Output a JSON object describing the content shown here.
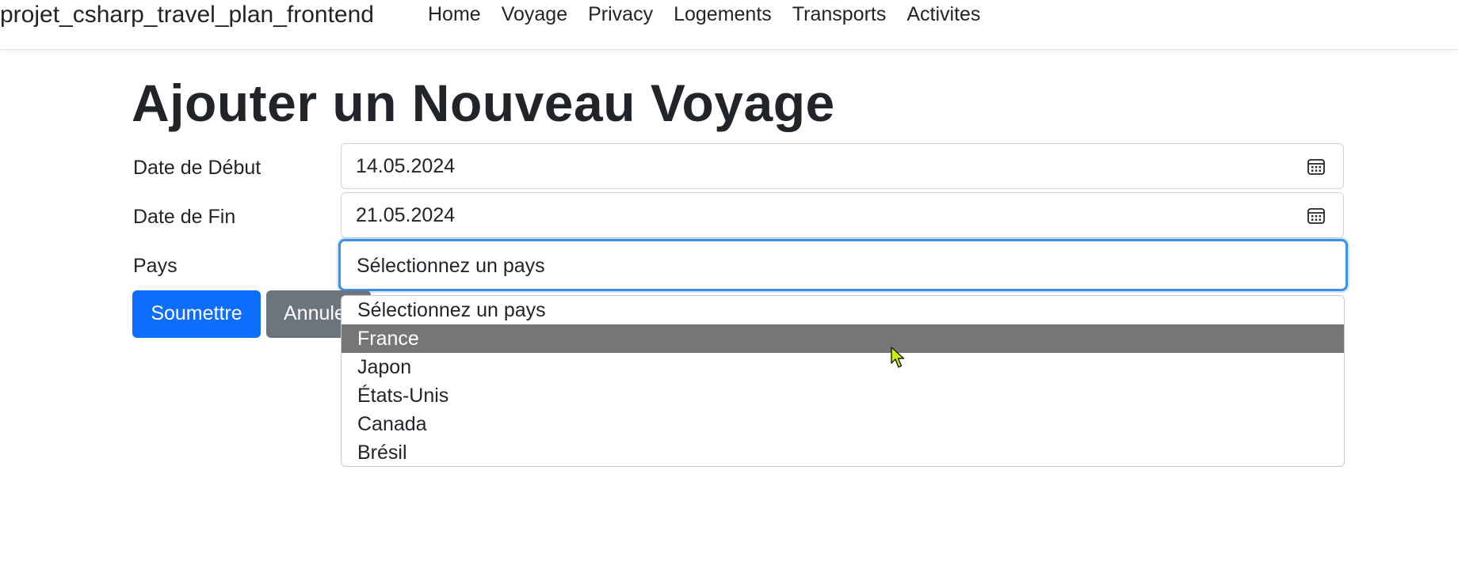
{
  "navbar": {
    "brand": "projet_csharp_travel_plan_frontend",
    "links": [
      "Home",
      "Voyage",
      "Privacy",
      "Logements",
      "Transports",
      "Activites"
    ]
  },
  "page": {
    "title": "Ajouter un Nouveau Voyage"
  },
  "form": {
    "start_date": {
      "label": "Date de Début",
      "value": "14.05.2024",
      "icon": "calendar-icon"
    },
    "end_date": {
      "label": "Date de Fin",
      "value": "21.05.2024",
      "icon": "calendar-icon"
    },
    "country": {
      "label": "Pays",
      "selected": "Sélectionnez un pays",
      "options": [
        "Sélectionnez un pays",
        "France",
        "Japon",
        "États-Unis",
        "Canada",
        "Brésil"
      ],
      "highlighted_index": 1
    },
    "submit_label": "Soumettre",
    "cancel_label": "Annuler"
  },
  "colors": {
    "primary": "#0d6efd",
    "secondary": "#6c757d",
    "focus_border": "#3b8fe6",
    "option_highlight": "#767676"
  }
}
